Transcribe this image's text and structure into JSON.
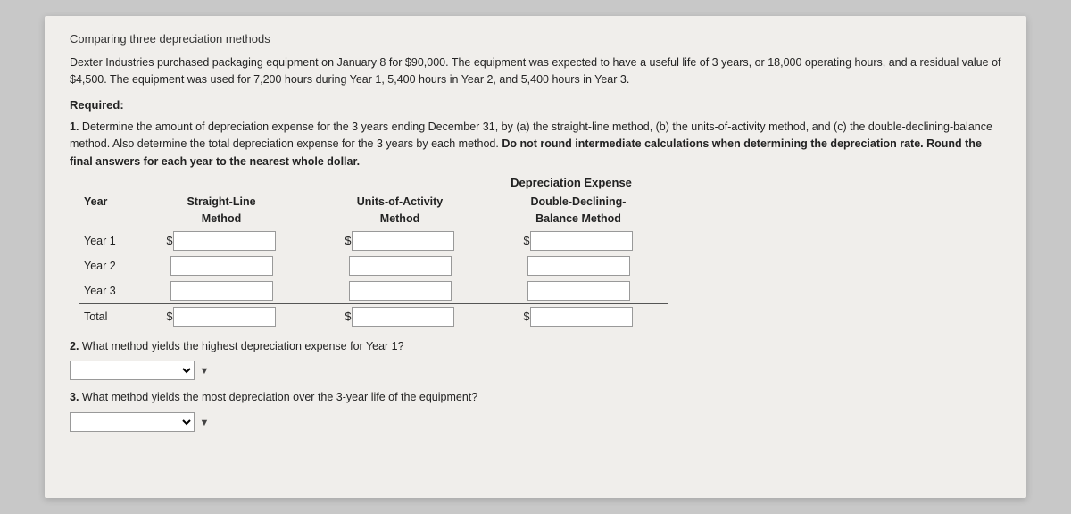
{
  "page": {
    "title": "Comparing three depreciation methods",
    "intro": "Dexter Industries purchased packaging equipment on January 8 for $90,000. The equipment was expected to have a useful life of 3 years, or 18,000 operating hours, and a residual value of $4,500. The equipment was used for 7,200 hours during Year 1, 5,400 hours in Year 2, and 5,400 hours in Year 3.",
    "required_label": "Required:",
    "question1": {
      "number": "1.",
      "text_plain": "Determine the amount of depreciation expense for the 3 years ending December 31, by (a) the straight-line method, (b) the units-of-activity method, and (c) the double-declining-balance method. Also determine the total depreciation expense for the 3 years by each method.",
      "bold_text": "Do not round intermediate calculations when determining the depreciation rate. Round the final answers for each year to the nearest whole dollar.",
      "table_header": "Depreciation Expense",
      "col1_header_line1": "Straight-Line",
      "col1_header_line2": "Method",
      "col2_header_line1": "Units-of-Activity",
      "col2_header_line2": "Method",
      "col3_header_line1": "Double-Declining-",
      "col3_header_line2": "Balance Method",
      "year_col": "Year",
      "rows": [
        {
          "year": "Year 1",
          "show_dollar1": true,
          "show_dollar2": true,
          "show_dollar3": true
        },
        {
          "year": "Year 2",
          "show_dollar1": false,
          "show_dollar2": false,
          "show_dollar3": false
        },
        {
          "year": "Year 3",
          "show_dollar1": false,
          "show_dollar2": false,
          "show_dollar3": false
        },
        {
          "year": "Total",
          "show_dollar1": true,
          "show_dollar2": true,
          "show_dollar3": true
        }
      ]
    },
    "question2": {
      "number": "2.",
      "text": "What method yields the highest depreciation expense for Year 1?"
    },
    "question3": {
      "number": "3.",
      "text": "What method yields the most depreciation over the 3-year life of the equipment?"
    }
  }
}
